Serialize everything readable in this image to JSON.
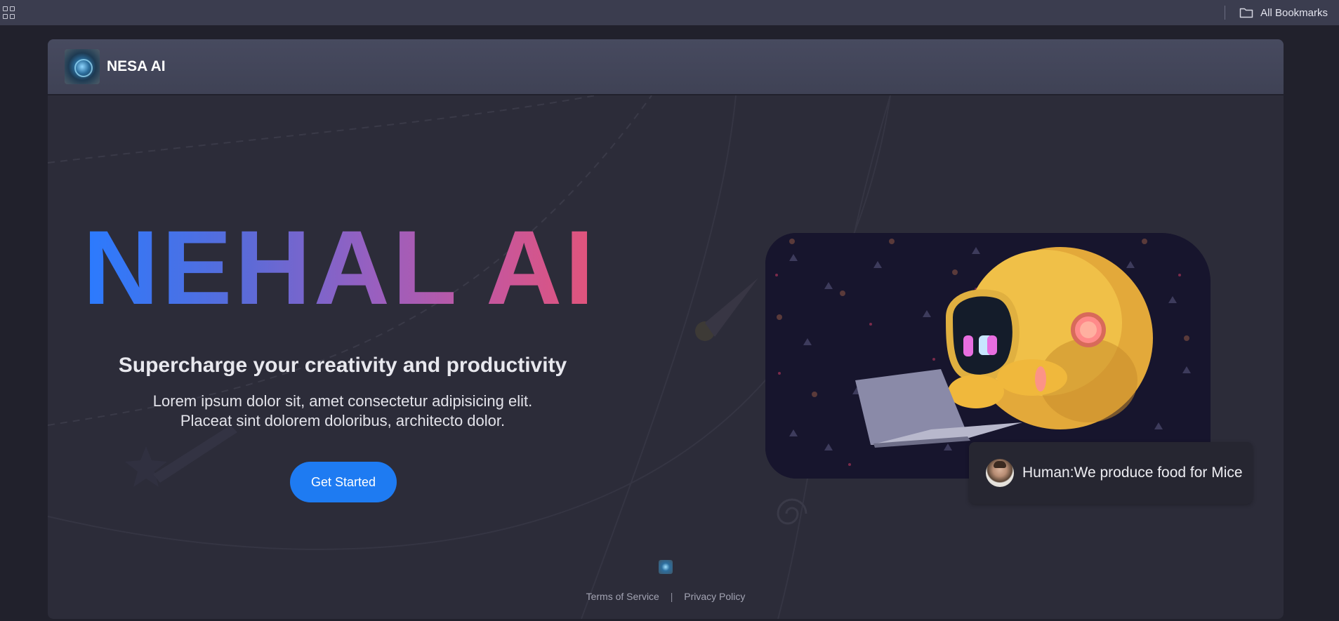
{
  "browser": {
    "bookmarks_label": "All Bookmarks",
    "apps_icon": "apps-grid-icon",
    "folder_icon": "folder-icon"
  },
  "header": {
    "brand": "NESA AI",
    "logo_icon": "nesa-logo"
  },
  "hero": {
    "title": "NEHAL AI",
    "subtitle": "Supercharge your creativity and productivity",
    "description": "Lorem ipsum dolor sit, amet consectetur adipisicing elit. Placeat sint dolorem doloribus, architecto dolor.",
    "cta_label": "Get Started",
    "title_gradient": [
      "#2a7bff",
      "#9a5fbf",
      "#e85473"
    ],
    "cta_color": "#1e7bf2"
  },
  "chat": {
    "message": "Human:We produce food for Mice"
  },
  "footer": {
    "terms_label": "Terms of Service",
    "separator": "|",
    "privacy_label": "Privacy Policy"
  }
}
